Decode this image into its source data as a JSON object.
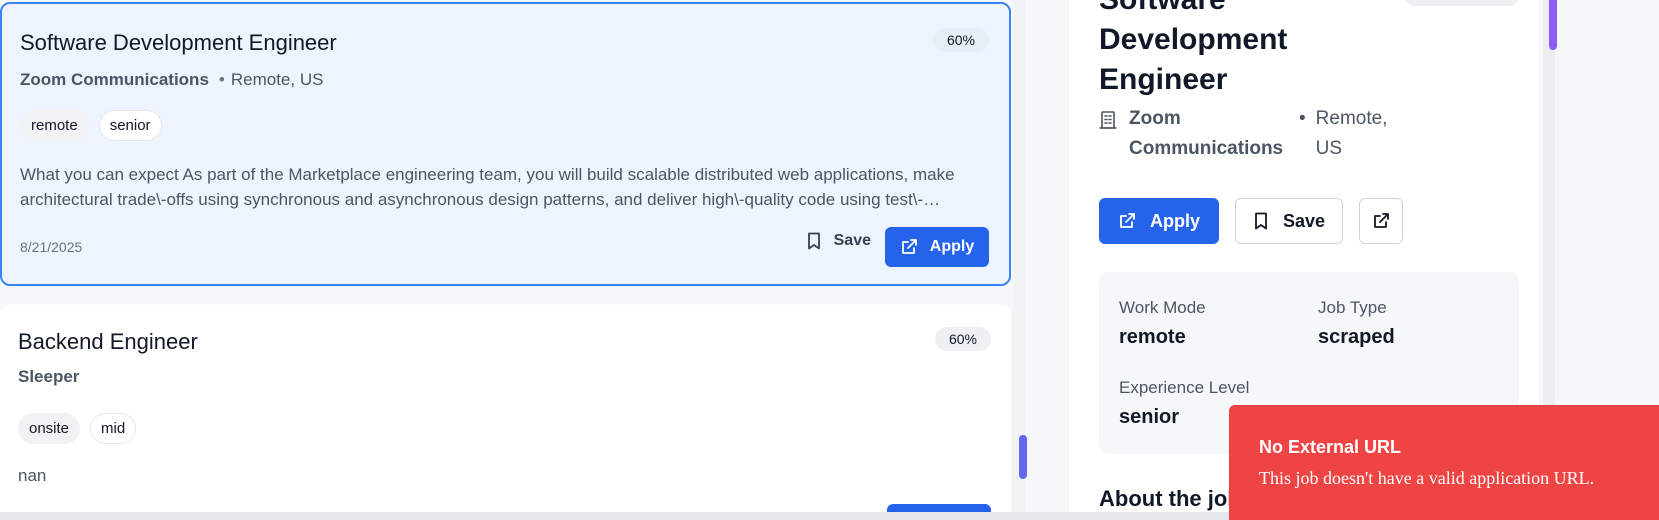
{
  "job_list": [
    {
      "title": "Software Development Engineer",
      "company": "Zoom Communications",
      "location": "Remote, US",
      "match": "60%",
      "tags": [
        "remote",
        "senior"
      ],
      "description": "What you can expect As part of the Marketplace engineering team, you will build scalable distributed web applications, make architectural trade\\-offs using synchronous and asynchronous design patterns, and deliver high\\-quality code using test\\-…",
      "date": "8/21/2025",
      "save_label": "Save",
      "apply_label": "Apply"
    },
    {
      "title": "Backend Engineer",
      "company": "Sleeper",
      "match": "60%",
      "tags": [
        "onsite",
        "mid"
      ],
      "description": "nan"
    }
  ],
  "detail": {
    "title": "Software Development Engineer",
    "company": "Zoom Communications",
    "location": "Remote, US",
    "apply_label": "Apply",
    "save_label": "Save",
    "info": {
      "work_mode_label": "Work Mode",
      "work_mode_value": "remote",
      "job_type_label": "Job Type",
      "job_type_value": "scraped",
      "experience_label": "Experience Level",
      "experience_value": "senior"
    },
    "about_heading": "About the job"
  },
  "toast": {
    "title": "No External URL",
    "message": "This job doesn't have a valid application URL."
  },
  "colors": {
    "accent": "#2563eb",
    "selected_border": "#3b82f6",
    "selected_bg": "#eef4fd",
    "toast_bg": "#ef4444",
    "scrollbar_thumb": "#6366f1"
  },
  "icons": [
    "bookmark-icon",
    "external-link-icon",
    "building-icon"
  ]
}
